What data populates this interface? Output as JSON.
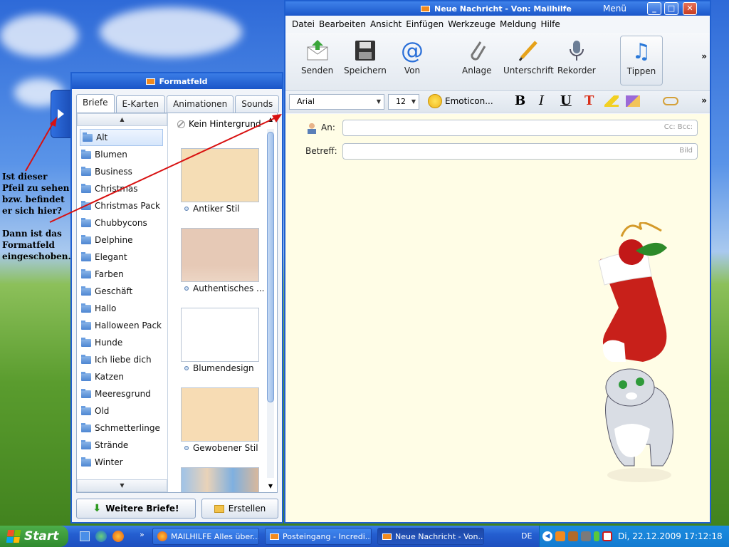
{
  "annotation": {
    "line1": "Ist dieser Pfeil zu sehen bzw. befindet er sich hier?",
    "line2": "Dann ist das Formatfeld eingeschoben."
  },
  "format_panel": {
    "title": "Formatfeld",
    "tabs": [
      "Briefe",
      "E-Karten",
      "Animationen",
      "Sounds"
    ],
    "categories": [
      "Alt",
      "Blumen",
      "Business",
      "Christmas",
      "Christmas Pack",
      "Chubbycons",
      "Delphine",
      "Elegant",
      "Farben",
      "Geschäft",
      "Hallo",
      "Halloween Pack",
      "Hunde",
      "Ich liebe dich",
      "Katzen",
      "Meeresgrund",
      "Old",
      "Schmetterlinge",
      "Strände",
      "Winter"
    ],
    "no_background": "Kein Hintergrund",
    "thumbnails": [
      "Antiker Stil",
      "Authentisches ...",
      "Blumendesign",
      "Gewobener Stil"
    ],
    "more_button": "Weitere Briefe!",
    "create_button": "Erstellen"
  },
  "mail_window": {
    "title": "Neue Nachricht - Von: Mailhilfe",
    "menu_label": "Menü",
    "menu": [
      "Datei",
      "Bearbeiten",
      "Ansicht",
      "Einfügen",
      "Werkzeuge",
      "Meldung",
      "Hilfe"
    ],
    "toolbar": [
      "Senden",
      "Speichern",
      "Von",
      "Anlage",
      "Unterschrift",
      "Rekorder",
      "Tippen"
    ],
    "font": "Arial",
    "size": "12",
    "emoticon": "Emoticon...",
    "to_label": "An:",
    "ccbcc": "Cc: Bcc:",
    "subject_label": "Betreff:",
    "bild": "Bild"
  },
  "taskbar": {
    "start": "Start",
    "tasks": [
      "MAILHILFE Alles über...",
      "Posteingang - Incredi...",
      "Neue Nachricht - Von..."
    ],
    "lang": "DE",
    "clock": "Di, 22.12.2009 17:12:18"
  }
}
